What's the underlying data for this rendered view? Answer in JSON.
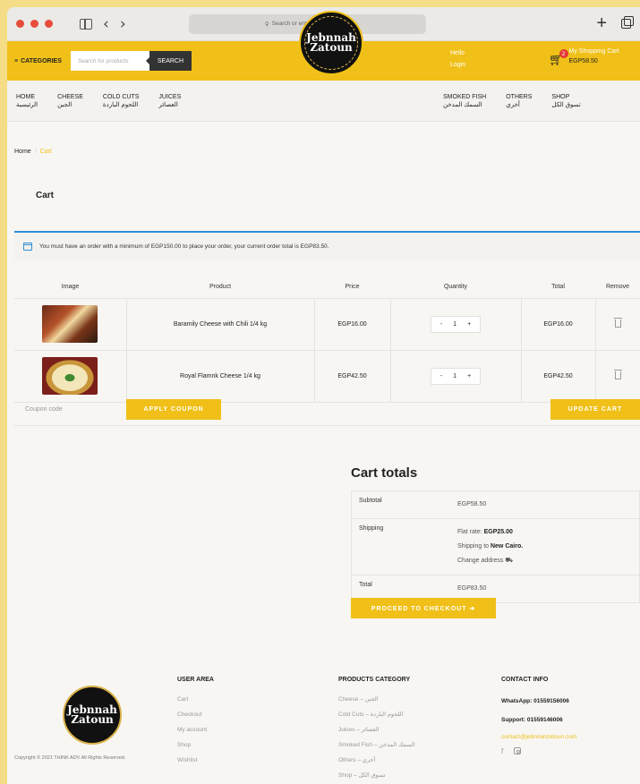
{
  "browser": {
    "url_placeholder": "Search or enter website name",
    "back": "‹",
    "forward": "›",
    "new_tab": "+"
  },
  "header": {
    "categories": "CATEGORIES",
    "search_placeholder": "Search for products",
    "search_button": "SEARCH",
    "logo_top": "Jebnnah",
    "logo_bottom": "Zatoun",
    "hello": "Hello",
    "login": "Login",
    "cart_label": "My Shopping Cart",
    "cart_amount": "EGP58.50",
    "cart_count": "2"
  },
  "nav": {
    "left": [
      {
        "en": "HOME",
        "ar": "الرئيسية"
      },
      {
        "en": "CHEESE",
        "ar": "الجبن"
      },
      {
        "en": "COLD CUTS",
        "ar": "اللحوم الباردة"
      },
      {
        "en": "JUICES",
        "ar": "العصائر"
      }
    ],
    "right": [
      {
        "en": "SMOKED FISH",
        "ar": "السمك المدخن"
      },
      {
        "en": "OTHERS",
        "ar": "أخري"
      },
      {
        "en": "SHOP",
        "ar": "تسوق الكل"
      }
    ]
  },
  "breadcrumb": {
    "home": "Home",
    "sep": "/",
    "current": "Cart"
  },
  "page_title": "Cart",
  "notice": "You must have an order with a minimum of EGP150.00 to place your order, your current order total is EGP83.50.",
  "table": {
    "headers": [
      "Image",
      "Product",
      "Price",
      "Quantity",
      "Total",
      "Remove"
    ],
    "rows": [
      {
        "product": "Baramily Cheese with Chili 1/4 kg",
        "price": "EGP16.00",
        "qty": "1",
        "total": "EGP16.00"
      },
      {
        "product": "Royal Flamnk Cheese 1/4 kg",
        "price": "EGP42.50",
        "qty": "1",
        "total": "EGP42.50"
      }
    ],
    "minus": "-",
    "plus": "+"
  },
  "coupon": {
    "placeholder": "Coupon code",
    "apply": "APPLY COUPON",
    "update": "UPDATE CART"
  },
  "totals": {
    "title": "Cart totals",
    "subtotal_label": "Subtotal",
    "subtotal": "EGP58.50",
    "shipping_label": "Shipping",
    "flat_rate_prefix": "Flat rate:",
    "flat_rate": "EGP25.00",
    "shipping_to_prefix": "Shipping to",
    "shipping_to": "New Cairo.",
    "change_address": "Change address",
    "total_label": "Total",
    "total": "EGP83.50",
    "checkout": "PROCEED TO CHECKOUT ➔"
  },
  "footer": {
    "copyright": "Copyright © 2021 THINK ADV All Rights Reserved.",
    "user_area": {
      "title": "USER AREA",
      "links": [
        "Cart",
        "Checkout",
        "My account",
        "Shop",
        "Wishlist"
      ]
    },
    "products": {
      "title": "PRODUCTS CATEGORY",
      "links": [
        "Cheese – الجبن",
        "Cold Cuts – اللحوم الباردة",
        "Juices – العصائر",
        "Smoked Fish – السمك المدخن",
        "Others – أخري",
        "Shop – تسوق الكل"
      ]
    },
    "contact": {
      "title": "CONTACT INFO",
      "whatsapp": "WhatsApp: 01559156006",
      "support": "Support: 01559146006",
      "email": "contact@jebnnahzatoun.com"
    }
  },
  "colors": {
    "accent": "#f0c018",
    "info": "#2e8fd8",
    "background": "#f4dd86"
  }
}
